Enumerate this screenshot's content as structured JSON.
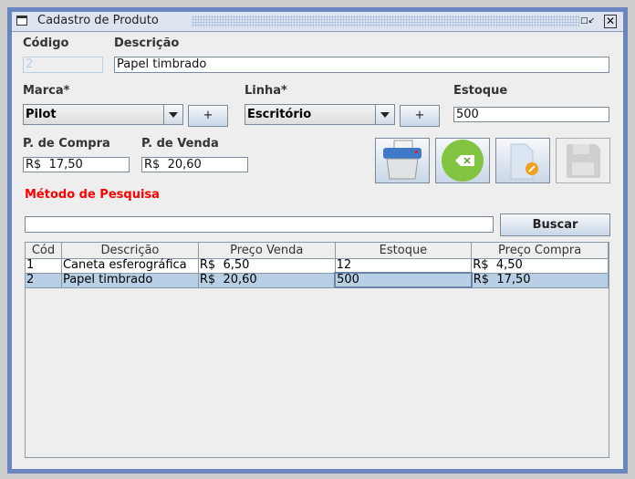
{
  "window": {
    "title": "Cadastro de Produto"
  },
  "form": {
    "codigo_label": "Código",
    "codigo_value": "2",
    "descricao_label": "Descrição",
    "descricao_value": "Papel timbrado",
    "marca_label": "Marca*",
    "marca_value": "Pilot",
    "add_label": "+",
    "linha_label": "Linha*",
    "linha_value": "Escritório",
    "estoque_label": "Estoque",
    "estoque_value": "500",
    "compra_label": "P. de Compra",
    "compra_value": "R$  17,50",
    "venda_label": "P. de Venda",
    "venda_value": "R$  20,60"
  },
  "search": {
    "label": "Método de Pesquisa",
    "value": "",
    "button": "Buscar",
    "label_color": "#ff0000"
  },
  "table": {
    "headers": [
      "Cód",
      "Descrição",
      "Preço Venda",
      "Estoque",
      "Preço Compra"
    ],
    "rows": [
      [
        "1",
        "Caneta esferográfica",
        "R$  6,50",
        "12",
        "R$  4,50"
      ],
      [
        "2",
        "Papel timbrado",
        "R$  20,60",
        "500",
        "R$  17,50"
      ]
    ]
  }
}
